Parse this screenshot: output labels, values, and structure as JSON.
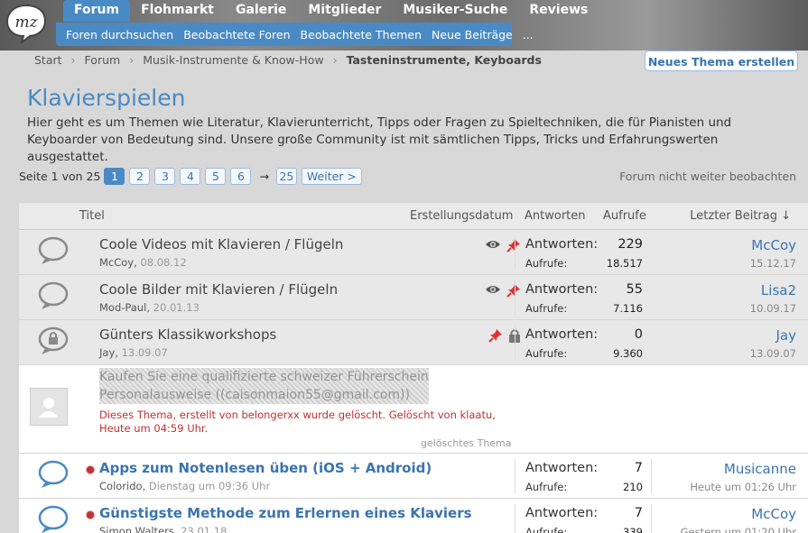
{
  "nav": {
    "tabs": [
      "Forum",
      "Flohmarkt",
      "Galerie",
      "Mitglieder",
      "Musiker-Suche",
      "Reviews"
    ],
    "subtabs": [
      "Foren durchsuchen",
      "Beobachtete Foren",
      "Beobachtete Themen",
      "Neue Beiträge",
      "..."
    ]
  },
  "breadcrumb": [
    "Start",
    "Forum",
    "Musik-Instrumente & Know-How",
    "Tasteninstrumente, Keyboards"
  ],
  "new_thread_label": "Neues Thema erstellen",
  "page": {
    "title": "Klavierspielen",
    "description": "Hier geht es um Themen wie Literatur, Klavierunterricht, Tipps oder Fragen zu Spieltechniken, die für Pianisten und Keyboarder von Bedeutung sind. Unsere große Community ist mit sämtlichen Tipps, Tricks und Erfahrungswerten ausgestattet."
  },
  "pager": {
    "label": "Seite 1 von 25",
    "pages": [
      "1",
      "2",
      "3",
      "4",
      "5",
      "6"
    ],
    "arrow": "→",
    "last": "25",
    "next": "Weiter >"
  },
  "unwatch_label": "Forum nicht weiter beobachten",
  "columns": {
    "title": "Titel",
    "created": "Erstellungsdatum",
    "replies": "Antworten",
    "views": "Aufrufe",
    "last": "Letzter Beitrag ↓"
  },
  "labels": {
    "replies": "Antworten:",
    "views": "Aufrufe:"
  },
  "threads": [
    {
      "title": "Coole Videos mit Klavieren / Flügeln",
      "author": "McCoy",
      "date": "08.08.12",
      "replies": "229",
      "views": "18.517",
      "last_user": "McCoy",
      "last_date": "15.12.17"
    },
    {
      "title": "Coole Bilder mit Klavieren / Flügeln",
      "author": "Mod-Paul",
      "date": "20.01.13",
      "replies": "55",
      "views": "7.116",
      "last_user": "Lisa2",
      "last_date": "10.09.17"
    },
    {
      "title": "Günters Klassikworkshops",
      "author": "Jay",
      "date": "13.09.07",
      "replies": "0",
      "views": "9.360",
      "last_user": "Jay",
      "last_date": "13.09.07"
    },
    {
      "title": "Apps zum Notenlesen üben (iOS + Android)",
      "author": "Colorido",
      "date": "Dienstag um 09:36 Uhr",
      "replies": "7",
      "views": "210",
      "last_user": "Musicanne",
      "last_date": "Heute um 01:26 Uhr"
    },
    {
      "title": "Günstigste Methode zum Erlernen eines Klaviers",
      "author": "Simon Walters",
      "date": "23.01.18",
      "replies": "7",
      "views": "339",
      "last_user": "McCoy",
      "last_date": "Gestern um 01:20 Uhr"
    }
  ],
  "deleted": {
    "spam_line1": "Kaufen Sie eine qualifizierte schweizer Führerschein,",
    "spam_line2": "Personalausweise ((caisonmaion55@gmail.com))",
    "notice": "Dieses Thema, erstellt von belongerxx wurde gelöscht. Gelöscht von klaatu,",
    "notice2": "Heute um 04:59 Uhr.",
    "tag": "gelöschtes Thema"
  }
}
